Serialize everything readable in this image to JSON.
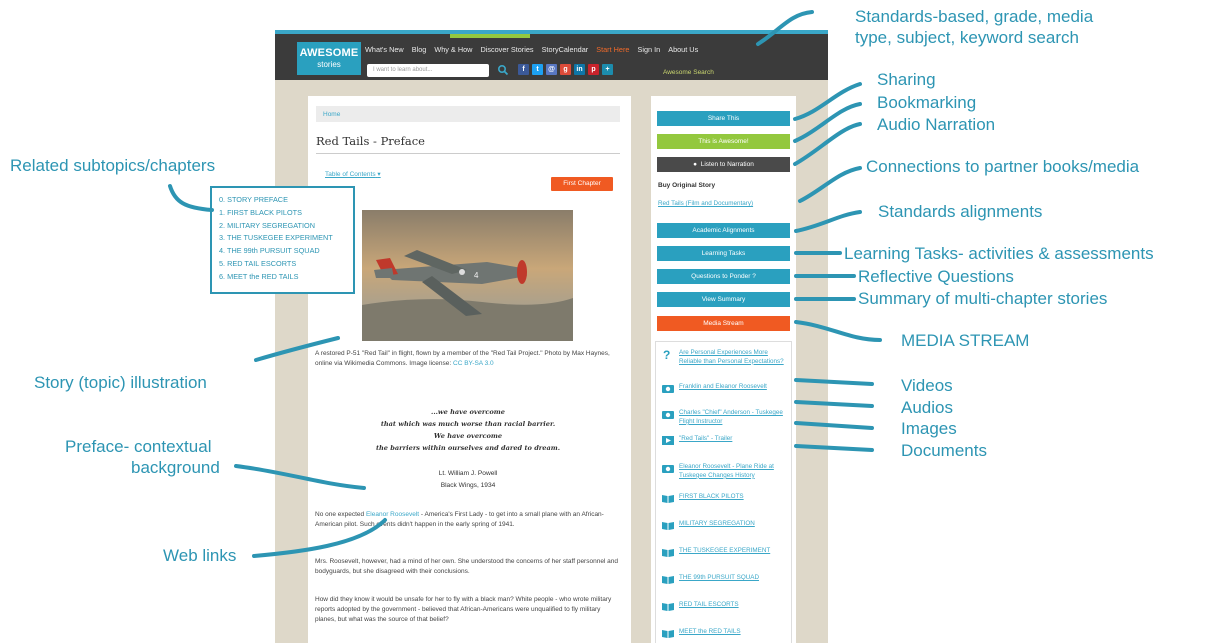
{
  "site": {
    "logo_line1": "AWESOME",
    "logo_line2": "stories",
    "nav_items": [
      "What's New",
      "Blog",
      "Why & How",
      "Discover Stories",
      "StoryCalendar",
      "Start Here",
      "Sign In",
      "About Us"
    ],
    "search_placeholder": "I want to learn about...",
    "social_icons": [
      "facebook-icon",
      "twitter-icon",
      "email-icon",
      "google-plus-icon",
      "linkedin-icon",
      "pinterest-icon",
      "share-icon"
    ],
    "awesome_search": "Awesome Search"
  },
  "page": {
    "breadcrumb": "Home",
    "title": "Red Tails - Preface",
    "toc_link": "Table of Contents",
    "first_chapter": "First Chapter",
    "caption_text": "A restored P-51 \"Red Tail\" in flight, flown by a member of the \"Red Tail Project.\"  Photo by Max Haynes, online via Wikimedia Commons.  Image license:",
    "caption_link": "CC BY-SA 3.0",
    "quote": [
      "...we have overcome",
      "that which was much worse than racial barrier.",
      "We have overcome",
      "the barriers within ourselves and dared to dream."
    ],
    "signature": [
      "Lt. William J. Powell",
      "Black Wings, 1934"
    ],
    "para1_before": "No one expected ",
    "para1_link": "Eleanor Roosevelt",
    "para1_after": " - America's First Lady - to get into a small plane with an African-American pilot.  Such events didn't happen in the early spring of 1941.",
    "para2": "Mrs. Roosevelt, however, had a mind of her own.  She understood the concerns of her staff personnel and  bodyguards, but she disagreed with their conclusions.",
    "para3": "How did they know it would be unsafe for her to fly with a black man?  White people - who wrote military reports adopted by the government - believed that African-Americans were unqualified to fly military planes, but what was the source of that belief?"
  },
  "sidebar": {
    "share": "Share This",
    "awesome": "This is Awesome!",
    "narration": "Listen to Narration",
    "buy_heading": "Buy Original Story",
    "buy_link": "Red Tails (Film and Documentary)",
    "academic": "Academic  Alignments",
    "learning": "Learning Tasks",
    "questions": "Questions to Ponder ?",
    "summary": "View Summary",
    "media_stream": "Media Stream",
    "stream_items": [
      {
        "icon": "question-icon",
        "text": "Are Personal Experiences More Reliable than Personal Expectations?"
      },
      {
        "icon": "camera-icon",
        "text": "Franklin and Eleanor Roosevelt"
      },
      {
        "icon": "camera-icon",
        "text": "Charles \"Chief\" Anderson - Tuskegee Flight Instructor"
      },
      {
        "icon": "video-icon",
        "text": "\"Red Tails\" - Trailer"
      },
      {
        "icon": "camera-icon",
        "text": "Eleanor Roosevelt - Plane Ride at Tuskegee Changes History"
      },
      {
        "icon": "book-icon",
        "text": "FIRST BLACK PILOTS"
      },
      {
        "icon": "book-icon",
        "text": "MILITARY SEGREGATION"
      },
      {
        "icon": "book-icon",
        "text": "THE TUSKEGEE EXPERIMENT"
      },
      {
        "icon": "book-icon",
        "text": "THE 99th PURSUIT SQUAD"
      },
      {
        "icon": "book-icon",
        "text": "RED TAIL ESCORTS"
      },
      {
        "icon": "book-icon",
        "text": "MEET the RED TAILS"
      }
    ]
  },
  "toc_popup": [
    "0. STORY PREFACE",
    "1. FIRST BLACK PILOTS",
    "2. MILITARY SEGREGATION",
    "3. THE TUSKEGEE EXPERIMENT",
    "4. THE 99th PURSUIT SQUAD",
    "5. RED TAIL ESCORTS",
    "6. MEET the RED TAILS"
  ],
  "annotations": {
    "search_line1": "Standards-based, grade, media",
    "search_line2": "type, subject, keyword search",
    "sharing": "Sharing",
    "bookmarking": "Bookmarking",
    "audio_narration": "Audio Narration",
    "connections": "Connections to partner books/media",
    "standards": "Standards alignments",
    "learning_tasks": "Learning Tasks- activities & assessments",
    "reflective": "Reflective Questions",
    "summary": "Summary of multi-chapter stories",
    "media_stream": "MEDIA STREAM",
    "videos": "Videos",
    "audios": "Audios",
    "images": "Images",
    "documents": "Documents",
    "related": "Related subtopics/chapters",
    "illustration": "Story (topic) illustration",
    "preface_line1": "Preface- contextual",
    "preface_line2": "background",
    "weblinks": "Web links"
  },
  "colors": {
    "accent": "#2d95b3",
    "teal_button": "#2aa0bf",
    "green_button": "#93c83e",
    "dark_button": "#4a4a4a",
    "orange": "#f05a22",
    "nav_bg": "#3b3b3b"
  }
}
